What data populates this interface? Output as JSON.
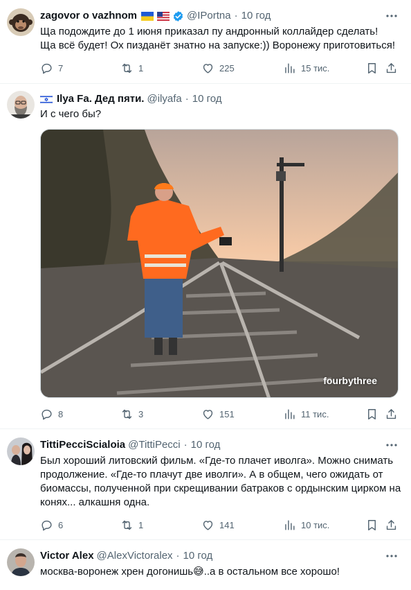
{
  "tweets": [
    {
      "name": "zagovor o vazhnom",
      "handle": "@IPortna",
      "time": "10 год",
      "text": "Ща подождите до 1 июня приказал пу андронный коллайдер сделать!\nЩа всё будет! Ох пизданёт знатно на запуске:)) Воронежу приготовиться!",
      "replies": "7",
      "retweets": "1",
      "likes": "225",
      "views": "15 тис."
    },
    {
      "name": "Ilya Fa. Дед пяти.",
      "handle": "@ilyafa",
      "time": "10 год",
      "text": "И с чего бы?",
      "replies": "8",
      "retweets": "3",
      "likes": "151",
      "views": "11 тис.",
      "media_watermark": "fourbythree"
    },
    {
      "name": "TittiPecciScialoia",
      "handle": "@TittiPecci",
      "time": "10 год",
      "text": "Был хороший литовский фильм. «Где-то плачет иволга». Можно снимать продолжение. «Где-то плачут две иволги». А в общем, чего ожидать от биомассы, полученной при скрещивании батраков с ордынским цирком на конях... алкашня одна.",
      "replies": "6",
      "retweets": "1",
      "likes": "141",
      "views": "10 тис."
    },
    {
      "name": "Victor Alex",
      "handle": "@AlexVictoralex",
      "time": "10 год",
      "text": "москва-воронеж хрен догонишь😅..а в остальном все хорошо!"
    }
  ],
  "icons": {
    "reply": "reply-icon",
    "retweet": "retweet-icon",
    "like": "heart-icon",
    "views": "views-chart-icon",
    "bookmark": "bookmark-icon",
    "share": "share-icon",
    "more": "more-dots-icon"
  },
  "colors": {
    "text": "#0f1419",
    "secondary": "#536471",
    "divider": "#eff3f4",
    "verified": "#1d9bf0"
  }
}
